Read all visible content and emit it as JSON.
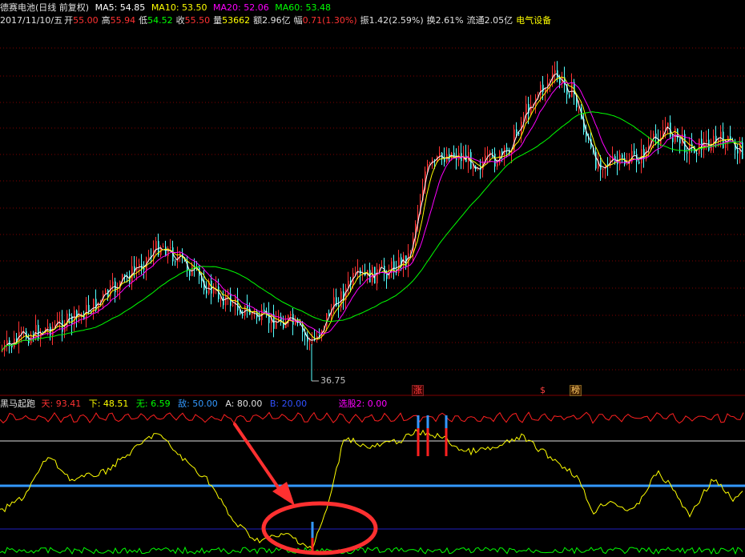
{
  "header": {
    "stock_title": "德赛电池(日线 前复权)",
    "ma5": "MA5: 54.85",
    "ma10": "MA10: 53.50",
    "ma20": "MA20: 52.06",
    "ma60": "MA60: 53.48",
    "date": "2017/11/10/五",
    "open_label": "开",
    "open": "55.00",
    "high_label": "高",
    "high": "55.94",
    "low_label": "低",
    "low": "54.52",
    "close_label": "收",
    "close": "55.50",
    "volume_label": "量",
    "volume": "53662",
    "amount": "额2.96亿",
    "change_label": "幅",
    "change": "0.71(1.30%)",
    "amplitude": "振1.42(2.59%)",
    "turnover": "换2.61%",
    "float_cap": "流通2.05亿",
    "sector": "电气设备"
  },
  "price_panel": {
    "low_marker": "36.75",
    "tags": [
      "涨",
      "$",
      "榜"
    ]
  },
  "indicator": {
    "name": "黑马起跑",
    "tian": "天: 93.41",
    "xia": "下: 48.51",
    "wu": "无: 6.59",
    "di": "敌: 50.00",
    "a": "A: 80.00",
    "b": "B: 20.00",
    "xuangu": "选股2: 0.00"
  },
  "colors": {
    "background": "#000000",
    "up_candle": "#ff3232",
    "down_candle": "#54ffff",
    "ma5": "#ffffff",
    "ma10": "#ffff00",
    "ma20": "#ff00ff",
    "ma60": "#00ff00",
    "grid": "#800000",
    "annotation": "#ff3030",
    "line_80": "#3399ff",
    "line_20": "#2020c0"
  }
}
